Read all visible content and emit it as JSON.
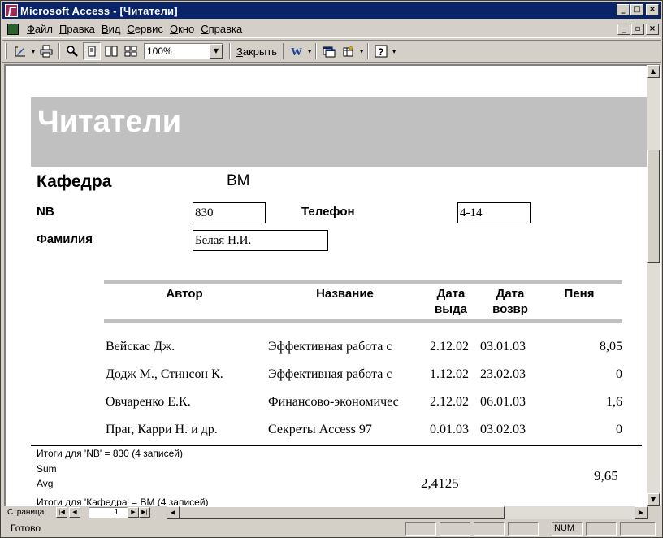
{
  "window": {
    "title": "Microsoft Access - [Читатели]",
    "caption_buttons": [
      "_",
      "□",
      "×"
    ],
    "mdi_buttons": [
      "_",
      "▫",
      "×"
    ]
  },
  "menu": {
    "items": [
      {
        "key": "Ф",
        "rest": "айл"
      },
      {
        "key": "П",
        "rest": "равка"
      },
      {
        "key": "В",
        "rest": "ид"
      },
      {
        "key": "С",
        "rest": "ервис"
      },
      {
        "key": "О",
        "rest": "кно"
      },
      {
        "key": "С",
        "rest": "правка"
      }
    ]
  },
  "toolbar": {
    "zoom_value": "100%",
    "close_key": "З",
    "close_rest": "акрыть",
    "icons": [
      "design-view-icon",
      "print-icon",
      "zoom-icon",
      "one-page-icon",
      "two-pages-icon",
      "multiple-pages-icon",
      "word-icon",
      "database-window-icon",
      "new-object-icon",
      "help-icon"
    ]
  },
  "report": {
    "title": "Читатели",
    "group_label": "Кафедра",
    "group_value": "ВМ",
    "nb_label": "NB",
    "nb_value": "830",
    "phone_label": "Телефон",
    "phone_value": "4-14",
    "surname_label": "Фамилия",
    "surname_value": "Белая Н.И.",
    "columns": {
      "author": "Автор",
      "title": "Название",
      "date_issue_1": "Дата",
      "date_issue_2": "выда",
      "date_return_1": "Дата",
      "date_return_2": "возвр",
      "fine": "Пеня"
    },
    "rows": [
      {
        "author": "Вейскас Дж.",
        "title": "Эффективная работа с",
        "issued": "2.12.02",
        "returned": "03.01.03",
        "fine": "8,05"
      },
      {
        "author": "Додж М., Стинсон К.",
        "title": "Эффективная работа с",
        "issued": "1.12.02",
        "returned": "23.02.03",
        "fine": "0"
      },
      {
        "author": "Овчаренко Е.К.",
        "title": "Финансово-экономичес",
        "issued": "2.12.02",
        "returned": "06.01.03",
        "fine": "1,6"
      },
      {
        "author": "Праг, Карри Н. и др.",
        "title": "Секреты Access 97",
        "issued": "0.01.03",
        "returned": "03.02.03",
        "fine": "0"
      }
    ],
    "summary_nb": "Итоги для 'NB' =  830 (4 записей)",
    "sum_label": "Sum",
    "avg_label": "Avg",
    "sum_value": "9,65",
    "avg_value": "2,4125",
    "summary_dept": "Итоги для 'Кафедра' =  ВМ (4 записей)"
  },
  "navigation": {
    "label": "Страница:",
    "page": "1"
  },
  "status": {
    "text": "Готово",
    "num": "NUM"
  }
}
